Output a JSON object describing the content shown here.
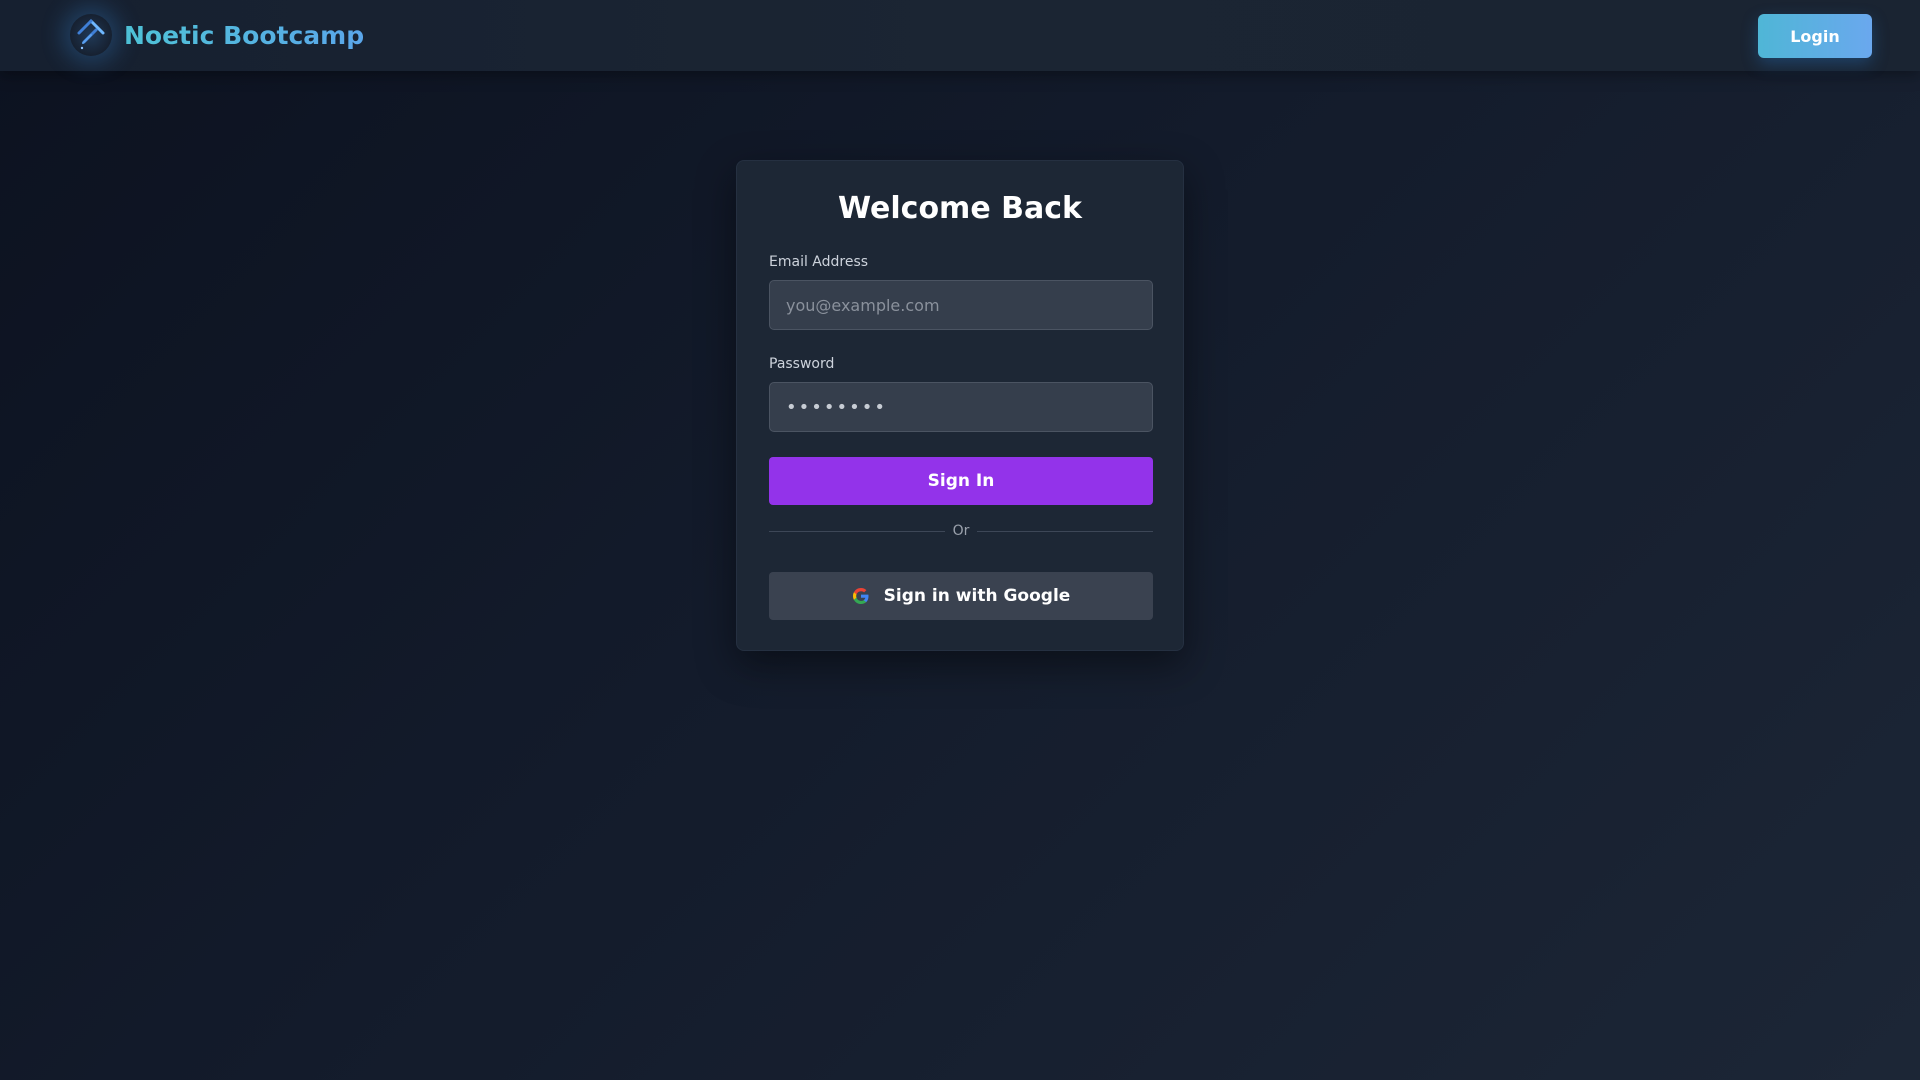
{
  "header": {
    "brand_name": "Noetic Bootcamp",
    "logo_icon": "diamond-logo-icon",
    "login_label": "Login"
  },
  "form": {
    "title": "Welcome Back",
    "email": {
      "label": "Email Address",
      "placeholder": "you@example.com",
      "value": ""
    },
    "password": {
      "label": "Password",
      "value": "••••••••"
    },
    "signin_label": "Sign In",
    "divider_label": "Or",
    "google_label": "Sign in with Google",
    "google_icon": "google-icon"
  },
  "colors": {
    "accent_purple": "#9333ea",
    "brand_teal": "#4fc3d6",
    "brand_blue": "#5aa6ea",
    "card_bg": "#1d2735"
  }
}
